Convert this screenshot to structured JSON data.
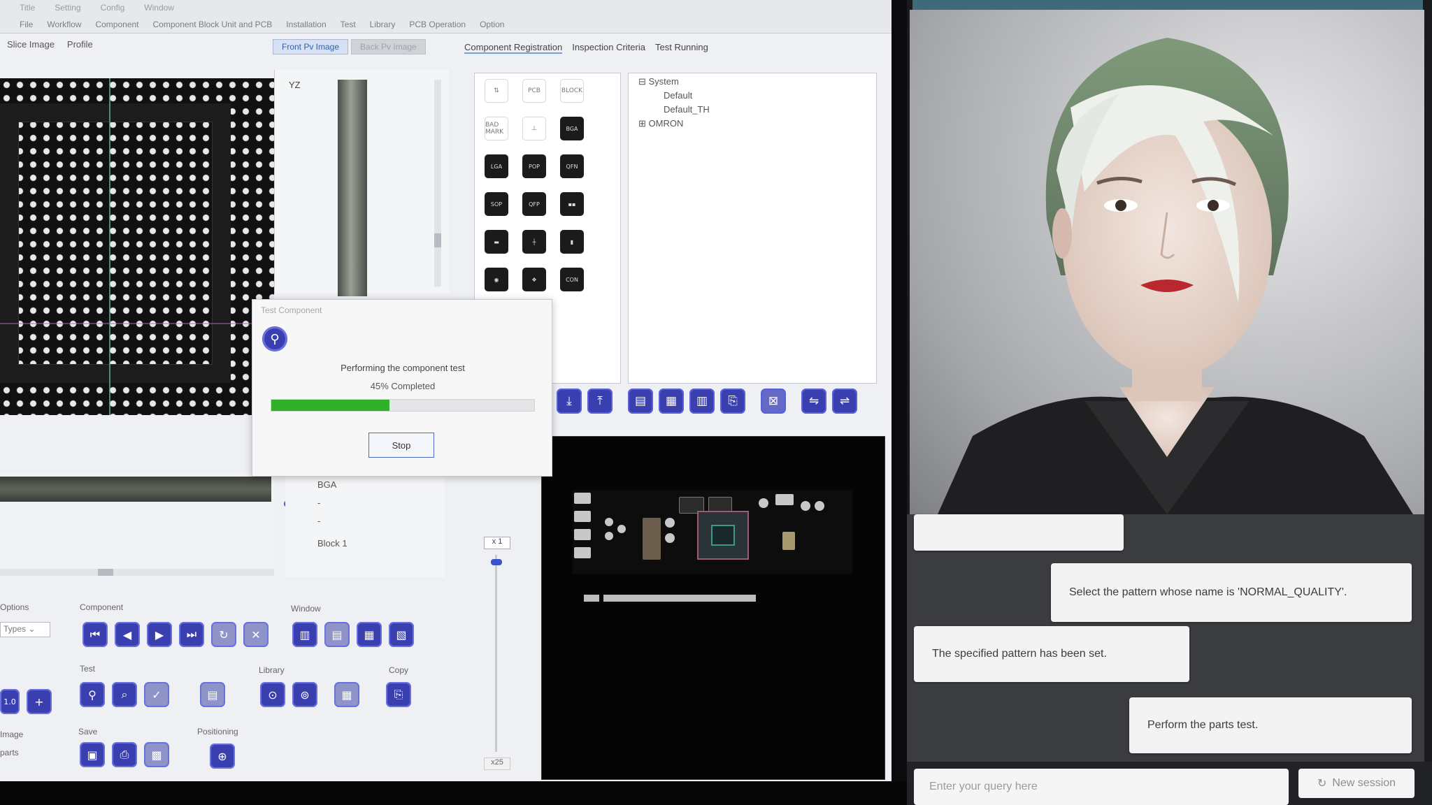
{
  "left_app": {
    "title_bar": [
      "Title",
      "Setting",
      "Config",
      "Window"
    ],
    "menu": [
      "File",
      "Workflow",
      "Component",
      "Component Block Unit and PCB",
      "Installation",
      "Test",
      "Library",
      "PCB Operation",
      "Option"
    ],
    "view_tabs": [
      "Slice Image",
      "Profile"
    ],
    "image_tabs": [
      "Front Pv Image",
      "Back Pv Image"
    ],
    "reg_tabs": [
      "Component Registration",
      "Inspection Criteria",
      "Test Running"
    ],
    "yz_label": "YZ",
    "palette_icons": [
      {
        "label": "⇅",
        "icon": "arrows-icon",
        "light": true
      },
      {
        "label": "PCB",
        "icon": "pcb-icon",
        "light": true
      },
      {
        "label": "BLOCK",
        "icon": "block-icon",
        "light": true
      },
      {
        "label": "BAD MARK",
        "icon": "bad-mark-icon",
        "light": true
      },
      {
        "label": "⊥",
        "icon": "fiducial-icon",
        "light": true
      },
      {
        "label": "BGA",
        "icon": "bga-icon",
        "light": false
      },
      {
        "label": "LGA",
        "icon": "lga-icon",
        "light": false
      },
      {
        "label": "POP",
        "icon": "pop-icon",
        "light": false
      },
      {
        "label": "QFN",
        "icon": "qfn-icon",
        "light": false
      },
      {
        "label": "SOP",
        "icon": "sop-icon",
        "light": false
      },
      {
        "label": "QFP",
        "icon": "qfp-icon",
        "light": false
      },
      {
        "label": "▪▪",
        "icon": "chip-array-icon",
        "light": false
      },
      {
        "label": "▬",
        "icon": "resistor-icon",
        "light": false
      },
      {
        "label": "┼",
        "icon": "cross-part-icon",
        "light": false
      },
      {
        "label": "▮",
        "icon": "capacitor-icon",
        "light": false
      },
      {
        "label": "◉",
        "icon": "round-part-icon",
        "light": false
      },
      {
        "label": "❖",
        "icon": "cluster-icon",
        "light": false
      },
      {
        "label": "CON",
        "icon": "connector-icon",
        "light": false
      }
    ],
    "tree": [
      {
        "label": "⊟ System",
        "level": 0
      },
      {
        "label": "Default",
        "level": 1
      },
      {
        "label": "Default_TH",
        "level": 1
      },
      {
        "label": "⊞ OMRON",
        "level": 0
      }
    ],
    "toolbar_icons": [
      {
        "glyph": "⤓",
        "name": "import-icon"
      },
      {
        "glyph": "⤒",
        "name": "export-icon"
      },
      {
        "glyph": "▤",
        "name": "save-icon"
      },
      {
        "glyph": "▦",
        "name": "grid-icon"
      },
      {
        "glyph": "▥",
        "name": "table-icon"
      },
      {
        "glyph": "⎘",
        "name": "copy-icon"
      },
      {
        "glyph": "⊠",
        "name": "delete-icon"
      },
      {
        "glyph": "⇋",
        "name": "swap-icon"
      },
      {
        "glyph": "⇌",
        "name": "swap-back-icon"
      }
    ],
    "zoom": {
      "top": "x 1",
      "bottom": "x25"
    },
    "block_list": [
      "BGA",
      "-",
      "-",
      "Block 1"
    ],
    "groups": {
      "options": "Options",
      "types": "Types",
      "component": "Component",
      "window": "Window",
      "test": "Test",
      "library": "Library",
      "copy": "Copy",
      "save": "Save",
      "positioning": "Positioning",
      "image": "Image",
      "parts": "parts",
      "zoom_value": "1.0"
    },
    "dialog": {
      "title": "Test Component",
      "message": "Performing the component test",
      "percent_text": "45% Completed",
      "progress": 0.45,
      "stop_label": "Stop"
    }
  },
  "assistant": {
    "chat": [
      {
        "role": "assistant",
        "text": ""
      },
      {
        "role": "user",
        "text": "Select the pattern whose name is 'NORMAL_QUALITY'."
      },
      {
        "role": "assistant",
        "text": "The specified pattern has been set."
      },
      {
        "role": "user",
        "text": "Perform the parts test."
      }
    ],
    "input_placeholder": "Enter your query here",
    "new_session_label": "New session"
  },
  "colors": {
    "accent_blue": "#3a3fb0",
    "progress_green": "#2fb22a",
    "chat_bg": "#3b3c3f"
  }
}
